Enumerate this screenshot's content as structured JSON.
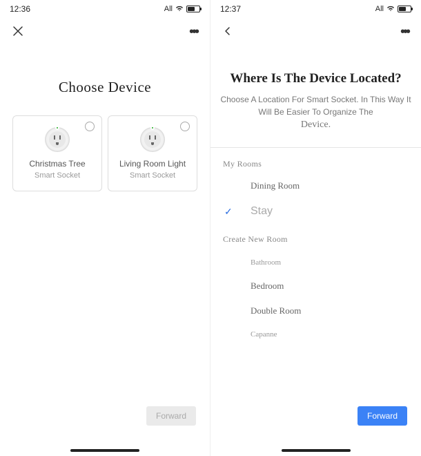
{
  "left": {
    "status": {
      "time": "12:36",
      "signal": "All"
    },
    "title": "Choose Device",
    "devices": [
      {
        "name": "Christmas Tree",
        "type": "Smart Socket"
      },
      {
        "name": "Living Room Light",
        "type": "Smart Socket"
      }
    ],
    "forward": "Forward"
  },
  "right": {
    "status": {
      "time": "12:37",
      "signal": "All"
    },
    "title": "Where Is The Device Located?",
    "subtitle_line1": "Choose A Location For Smart Socket. In This Way It Will Be Easier To Organize The",
    "subtitle_line2": "Device.",
    "my_rooms_label": "My Rooms",
    "my_rooms": [
      {
        "label": "Dining Room",
        "selected": false
      },
      {
        "label": "Stay",
        "selected": true
      }
    ],
    "create_label": "Create New Room",
    "new_rooms": [
      {
        "label": "Bathroom"
      },
      {
        "label": "Bedroom"
      },
      {
        "label": "Double Room"
      },
      {
        "label": "Capanne"
      }
    ],
    "forward": "Forward"
  }
}
